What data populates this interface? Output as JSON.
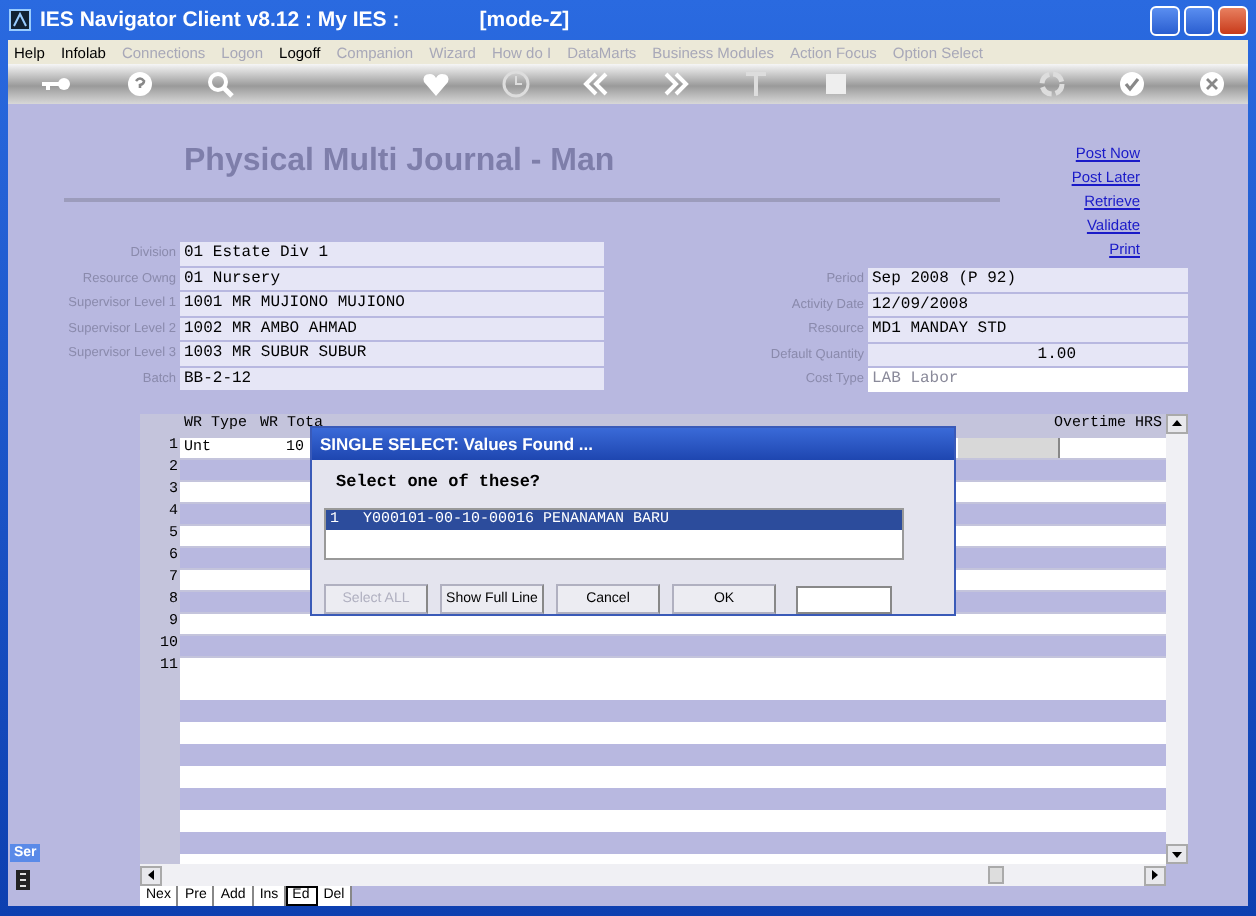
{
  "window": {
    "title": "IES Navigator Client v8.12 : My IES :",
    "mode": "[mode-Z]"
  },
  "menu": [
    {
      "label": "Help",
      "disabled": false
    },
    {
      "label": "Infolab",
      "disabled": false
    },
    {
      "label": "Connections",
      "disabled": true
    },
    {
      "label": "Logon",
      "disabled": true
    },
    {
      "label": "Logoff",
      "disabled": false
    },
    {
      "label": "Companion",
      "disabled": true
    },
    {
      "label": "Wizard",
      "disabled": true
    },
    {
      "label": "How do I",
      "disabled": true
    },
    {
      "label": "DataMarts",
      "disabled": true
    },
    {
      "label": "Business Modules",
      "disabled": true
    },
    {
      "label": "Action Focus",
      "disabled": true
    },
    {
      "label": "Option Select",
      "disabled": true
    }
  ],
  "form": {
    "title": "Physical Multi Journal - Man",
    "actions": [
      "Post Now",
      "Post Later",
      "Retrieve",
      "Validate",
      "Print"
    ],
    "left_fields": [
      {
        "label": "Division",
        "value": "01 Estate Div 1"
      },
      {
        "label": "Resource Owng",
        "value": "01 Nursery"
      },
      {
        "label": "Supervisor Level 1",
        "value": "1001 MR MUJIONO MUJIONO"
      },
      {
        "label": "Supervisor Level 2",
        "value": "1002 MR AMBO AHMAD"
      },
      {
        "label": "Supervisor Level 3",
        "value": "1003 MR SUBUR SUBUR"
      },
      {
        "label": "Batch",
        "value": "BB-2-12"
      }
    ],
    "right_fields": [
      {
        "label": "Period",
        "value": "Sep 2008 (P 92)",
        "kind": "text"
      },
      {
        "label": "Activity Date",
        "value": "12/09/2008",
        "kind": "text"
      },
      {
        "label": "Resource",
        "value": "MD1 MANDAY STD",
        "kind": "text"
      },
      {
        "label": "Default Quantity",
        "value": "1.00",
        "kind": "number"
      },
      {
        "label": "Cost Type",
        "value": "LAB Labor",
        "kind": "readonly"
      }
    ]
  },
  "grid": {
    "columns": [
      "WR Type",
      "WR Tota",
      "Overtime HRS"
    ],
    "rows": [
      {
        "number": "1",
        "cells": [
          "Unt",
          "10"
        ]
      },
      {
        "number": "2"
      },
      {
        "number": "3"
      },
      {
        "number": "4"
      },
      {
        "number": "5"
      },
      {
        "number": "6"
      },
      {
        "number": "7"
      },
      {
        "number": "8"
      },
      {
        "number": "9"
      },
      {
        "number": "10"
      },
      {
        "number": "11"
      }
    ],
    "tabs": [
      {
        "label": "Nex",
        "selected": false
      },
      {
        "label": "Pre",
        "selected": false
      },
      {
        "label": "Add",
        "selected": false
      },
      {
        "label": "Ins",
        "selected": false
      },
      {
        "label": "Ed",
        "selected": true
      },
      {
        "label": "Del",
        "selected": false
      }
    ]
  },
  "dialog": {
    "title": "SINGLE SELECT: Values Found ...",
    "prompt": "Select one of these?",
    "items": [
      {
        "number": "1",
        "text": "Y000101-00-10-00016 PENANAMAN BARU",
        "selected": true
      }
    ],
    "buttons": [
      {
        "label": "Select ALL",
        "disabled": true
      },
      {
        "label": "Show Full Line",
        "disabled": false
      },
      {
        "label": "Cancel",
        "disabled": false
      },
      {
        "label": "OK",
        "disabled": false
      }
    ]
  },
  "side_tab": {
    "label": "Ser"
  }
}
